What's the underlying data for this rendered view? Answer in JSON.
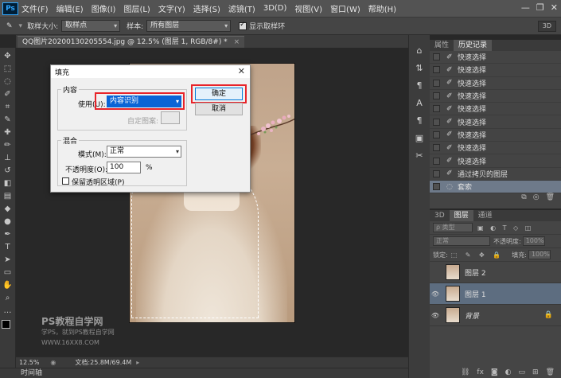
{
  "menu": {
    "logo": "Ps",
    "items": [
      "文件(F)",
      "编辑(E)",
      "图像(I)",
      "图层(L)",
      "文字(Y)",
      "选择(S)",
      "滤镜(T)",
      "3D(D)",
      "视图(V)",
      "窗口(W)",
      "帮助(H)"
    ]
  },
  "options": {
    "sample_size_label": "取样大小:",
    "sample_size_value": "取样点",
    "sample_label": "样本:",
    "sample_value": "所有图层",
    "show_ring_label": "显示取样环",
    "mode_3d": "3D"
  },
  "document": {
    "tab_title": "QQ图片20200130205554.jpg @ 12.5% (图层 1, RGB/8#) *",
    "zoom": "12.5%",
    "doc_info": "文档:25.8M/69.4M",
    "watermark_line1": "PS教程自学网",
    "watermark_line2": "学PS，就到PS教程自学网",
    "watermark_line3": "WWW.16XX8.COM"
  },
  "timeline_label": "时间轴",
  "fill_dialog": {
    "title": "填充",
    "content_legend": "内容",
    "use_label": "使用(U):",
    "use_value": "内容识别",
    "custom_pattern_label": "自定图案:",
    "blend_legend": "混合",
    "mode_label": "模式(M):",
    "mode_value": "正常",
    "opacity_label": "不透明度(O):",
    "opacity_value": "100",
    "opacity_unit": "%",
    "preserve_label": "保留透明区域(P)",
    "ok_label": "确定",
    "cancel_label": "取消"
  },
  "history_panel": {
    "tabs": [
      "属性",
      "历史记录"
    ],
    "items": [
      {
        "label": "快速选择",
        "selected": false
      },
      {
        "label": "快速选择",
        "selected": false
      },
      {
        "label": "快速选择",
        "selected": false
      },
      {
        "label": "快速选择",
        "selected": false
      },
      {
        "label": "快速选择",
        "selected": false
      },
      {
        "label": "快速选择",
        "selected": false
      },
      {
        "label": "快速选择",
        "selected": false
      },
      {
        "label": "快速选择",
        "selected": false
      },
      {
        "label": "快速选择",
        "selected": false
      },
      {
        "label": "通过拷贝的图层",
        "selected": false
      },
      {
        "label": "套索",
        "selected": true
      }
    ]
  },
  "layers_panel": {
    "tabs": [
      "3D",
      "图层",
      "通道"
    ],
    "kind_label": "ρ 类型",
    "blend_mode": "正常",
    "opacity_label": "不透明度:",
    "opacity_value": "100%",
    "lock_label": "锁定:",
    "fill_label": "填充:",
    "fill_value": "100%",
    "layers": [
      {
        "name": "图层 2",
        "selected": false,
        "visible": false
      },
      {
        "name": "图层 1",
        "selected": true,
        "visible": true
      },
      {
        "name": "背景",
        "selected": false,
        "visible": true
      }
    ]
  },
  "colors": {
    "accent_red": "#e8242a",
    "selection_blue": "#0a64d6"
  }
}
